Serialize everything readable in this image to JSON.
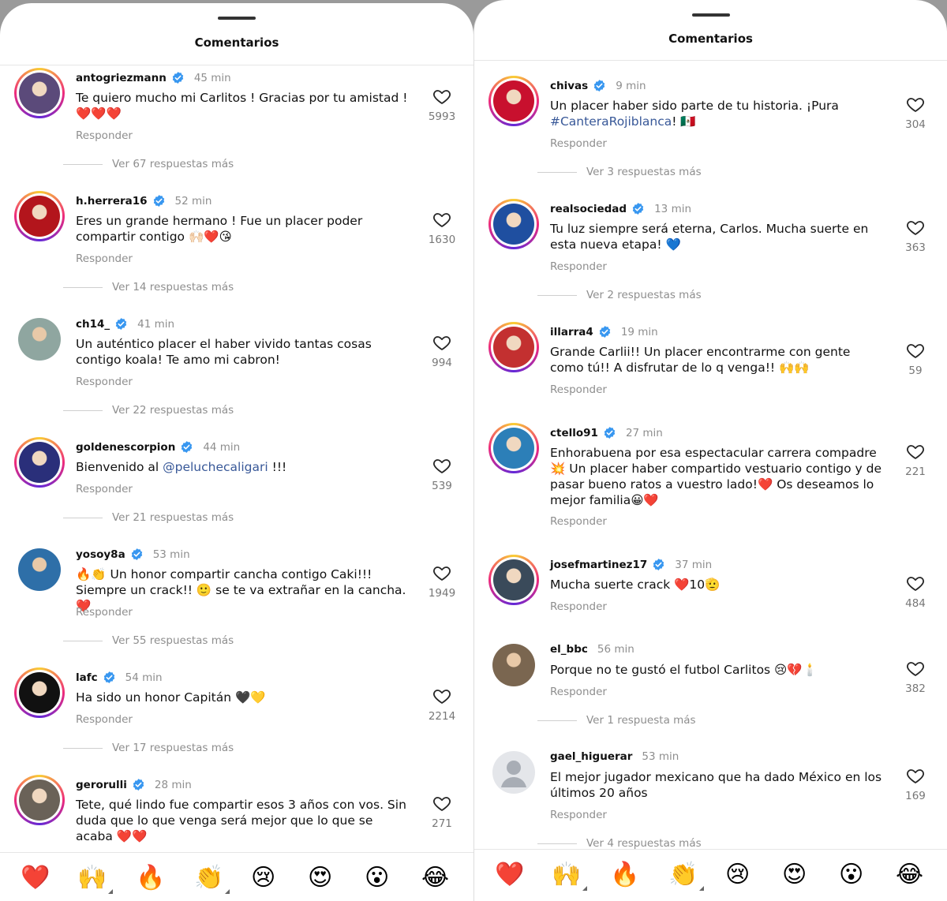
{
  "left_panel": {
    "title": "Comentarios",
    "comments": [
      {
        "user": "antogriezmann",
        "time": "45 min",
        "text": "Te quiero mucho mi Carlitos ! Gracias por tu amistad ! ❤️❤️❤️",
        "reply": "Responder",
        "likes": "5993",
        "more": "Ver 67 respuestas más",
        "avatar_color": "#5b4a7a"
      },
      {
        "user": "h.herrera16",
        "time": "52 min",
        "text": "Eres un grande hermano ! Fue un placer poder compartir contigo 🙌🏻❤️😘",
        "reply": "Responder",
        "likes": "1630",
        "more": "Ver 14 respuestas más",
        "avatar_color": "#b3151c"
      },
      {
        "user": "ch14_",
        "time": "41 min",
        "text": "Un auténtico placer el haber vivido tantas cosas contigo koala! Te amo mi cabron!",
        "reply": "Responder",
        "likes": "994",
        "more": "Ver 22 respuestas más",
        "avatar_color": "#8fa6a0"
      },
      {
        "user": "goldenescorpion",
        "time": "44 min",
        "text_before": "Bienvenido al ",
        "mention": "@peluchecaligari",
        "text_after": " !!!",
        "reply": "Responder",
        "likes": "539",
        "more": "Ver 21 respuestas más",
        "avatar_color": "#2a2f7a"
      },
      {
        "user": "yosoy8a",
        "time": "53 min",
        "text": "🔥👏 Un honor compartir cancha contigo Caki!!! Siempre un crack!! 🙂 se te va extrañar en la cancha. ❤️",
        "reply": "Responder",
        "likes": "1949",
        "more": "Ver 55 respuestas más",
        "avatar_color": "#2e6fa8"
      },
      {
        "user": "lafc",
        "time": "54 min",
        "text": "Ha sido un honor Capitán 🖤💛",
        "reply": "Responder",
        "likes": "2214",
        "more": "Ver 17 respuestas más",
        "avatar_color": "#111111"
      },
      {
        "user": "gerorulli",
        "time": "28 min",
        "text": "Tete, qué lindo fue compartir esos 3 años con vos. Sin duda que lo que venga será mejor que lo que se acaba ❤️❤️",
        "reply": "",
        "likes": "271",
        "more": "",
        "avatar_color": "#6a6258"
      }
    ]
  },
  "right_panel": {
    "title": "Comentarios",
    "comments": [
      {
        "user": "chivas",
        "time": "9 min",
        "text_before": "Un placer haber sido parte de tu historia. ¡Pura ",
        "mention": "#CanteraRojiblanca",
        "text_after": "! 🇲🇽",
        "reply": "Responder",
        "likes": "304",
        "more": "Ver 3 respuestas más",
        "avatar_color": "#c8102e"
      },
      {
        "user": "realsociedad",
        "time": "13 min",
        "text": "Tu luz siempre será eterna, Carlos. Mucha suerte en esta nueva etapa! 💙",
        "reply": "Responder",
        "likes": "363",
        "more": "Ver 2 respuestas más",
        "avatar_color": "#1f4fa0"
      },
      {
        "user": "illarra4",
        "time": "19 min",
        "text": "Grande Carlii!! Un placer encontrarme con gente como tú!! A disfrutar de lo q venga!! 🙌🙌",
        "reply": "Responder",
        "likes": "59",
        "more": "",
        "avatar_color": "#c33030"
      },
      {
        "user": "ctello91",
        "time": "27 min",
        "text": "Enhorabuena por esa espectacular carrera compadre💥 Un placer haber compartido vestuario contigo y de pasar bueno ratos a vuestro lado!❤️ Os deseamos lo mejor familia😀❤️",
        "reply": "Responder",
        "likes": "221",
        "more": "",
        "avatar_color": "#2c7fb8"
      },
      {
        "user": "josefmartinez17",
        "time": "37 min",
        "text": "Mucha suerte crack ❤️10🫡",
        "reply": "Responder",
        "likes": "484",
        "more": "",
        "avatar_color": "#3a4a5a"
      },
      {
        "user": "el_bbc",
        "time": "56 min",
        "text": "Porque no te gustó el futbol Carlitos 😢💔🕯️",
        "reply": "Responder",
        "likes": "382",
        "more": "Ver 1 respuesta más",
        "avatar_color": "#7a6650"
      },
      {
        "user": "gael_higuerar",
        "time": "53 min",
        "text": "El mejor jugador mexicano que ha dado México en los últimos 20 años",
        "reply": "Responder",
        "likes": "169",
        "more": "Ver 4 respuestas más",
        "avatar_color": "#c7cbd1"
      }
    ]
  },
  "reactions": [
    "❤️",
    "🙌",
    "🔥",
    "👏",
    "😢",
    "😍",
    "😮",
    "😂"
  ],
  "icons": {
    "like": "heart-outline-icon",
    "verified": "verified-badge-icon"
  }
}
